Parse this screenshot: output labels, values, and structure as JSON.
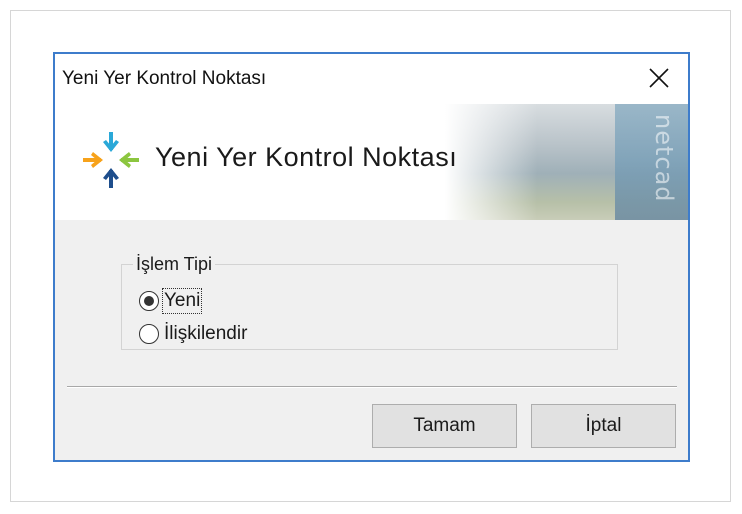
{
  "window": {
    "title": "Yeni Yer Kontrol Noktası"
  },
  "banner": {
    "title": "Yeni Yer Kontrol Noktası",
    "watermark": "netcad"
  },
  "group": {
    "label": "İşlem Tipi",
    "options": [
      {
        "label": "Yeni",
        "selected": true
      },
      {
        "label": "İlişkilendir",
        "selected": false
      }
    ]
  },
  "buttons": {
    "ok": "Tamam",
    "cancel": "İptal"
  },
  "colors": {
    "dialog_border": "#3d7ccb",
    "logo_cyan": "#2aa8d8",
    "logo_green": "#8cc63f",
    "logo_orange": "#f7a21b",
    "logo_navy": "#1e4e8c"
  },
  "icons": {
    "close": "close-icon",
    "logo": "netcad-logo-icon"
  }
}
